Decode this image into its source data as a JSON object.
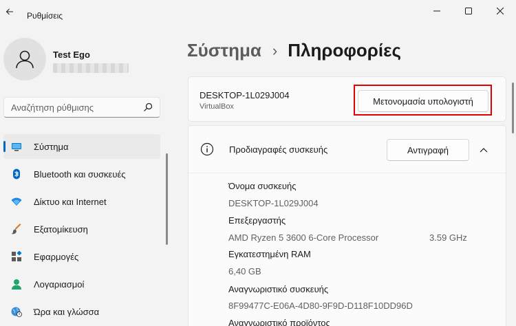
{
  "app": {
    "title": "Ρυθμίσεις"
  },
  "user": {
    "name": "Test Ego"
  },
  "search": {
    "placeholder": "Αναζήτηση ρύθμισης"
  },
  "nav": {
    "items": [
      {
        "label": "Σύστημα",
        "icon": "system-icon",
        "selected": true
      },
      {
        "label": "Bluetooth και συσκευές",
        "icon": "bluetooth-icon"
      },
      {
        "label": "Δίκτυο και Internet",
        "icon": "network-icon"
      },
      {
        "label": "Εξατομίκευση",
        "icon": "brush-icon"
      },
      {
        "label": "Εφαρμογές",
        "icon": "apps-icon"
      },
      {
        "label": "Λογαριασμοί",
        "icon": "accounts-icon"
      },
      {
        "label": "Ώρα και γλώσσα",
        "icon": "time-language-icon"
      }
    ]
  },
  "header": {
    "parent": "Σύστημα",
    "separator": "›",
    "current": "Πληροφορίες"
  },
  "device": {
    "name": "DESKTOP-1L029J004",
    "model": "VirtualBox",
    "rename_label": "Μετονομασία υπολογιστή"
  },
  "specs": {
    "title": "Προδιαγραφές συσκευής",
    "copy_label": "Αντιγραφή",
    "rows": [
      {
        "label": "Όνομα συσκευής",
        "value": "DESKTOP-1L029J004"
      },
      {
        "label": "Επεξεργαστής",
        "value": "AMD Ryzen 5 3600 6-Core Processor",
        "extra": "3.59 GHz"
      },
      {
        "label": "Εγκατεστημένη RAM",
        "value": "6,40 GB"
      },
      {
        "label": "Αναγνωριστικό συσκευής",
        "value": "8F99477C-E06A-4D80-9F9D-D118F10DD96D"
      },
      {
        "label": "Αναγνωριστικό προϊόντος"
      }
    ]
  },
  "colors": {
    "accent": "#0067c0",
    "highlight": "#e00000",
    "background": "#f3f3f3",
    "card": "#fbfbfb"
  }
}
